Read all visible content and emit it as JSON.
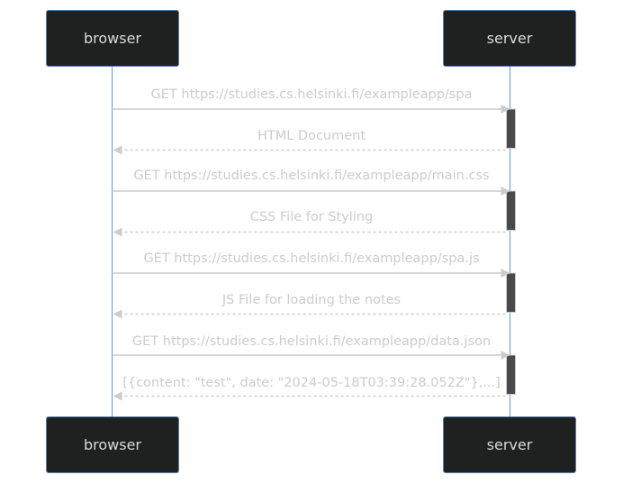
{
  "actors": {
    "left": "browser",
    "right": "server"
  },
  "messages": [
    {
      "from": "browser",
      "to": "server",
      "style": "solid",
      "text": "GET https://studies.cs.helsinki.fi/exampleapp/spa"
    },
    {
      "from": "server",
      "to": "browser",
      "style": "dashed",
      "text": "HTML Document"
    },
    {
      "from": "browser",
      "to": "server",
      "style": "solid",
      "text": "GET https://studies.cs.helsinki.fi/exampleapp/main.css"
    },
    {
      "from": "server",
      "to": "browser",
      "style": "dashed",
      "text": "CSS File for Styling"
    },
    {
      "from": "browser",
      "to": "server",
      "style": "solid",
      "text": "GET https://studies.cs.helsinki.fi/exampleapp/spa.js"
    },
    {
      "from": "server",
      "to": "browser",
      "style": "dashed",
      "text": "JS File for loading the notes"
    },
    {
      "from": "browser",
      "to": "server",
      "style": "solid",
      "text": "GET https://studies.cs.helsinki.fi/exampleapp/data.json"
    },
    {
      "from": "server",
      "to": "browser",
      "style": "dashed",
      "text": "[{content: \"test\", date: \"2024-05-18T03:39:28.052Z\"},...]"
    }
  ],
  "colors": {
    "actor_fill": "#1f2020",
    "actor_border": "#5a7fa8",
    "actor_text": "#d9d9d9",
    "lifeline": "#5a9bd5",
    "message_line": "#cccccc",
    "message_text": "#cccccc",
    "activation_fill": "#4a4a4a",
    "activation_border": "#cccccc"
  }
}
